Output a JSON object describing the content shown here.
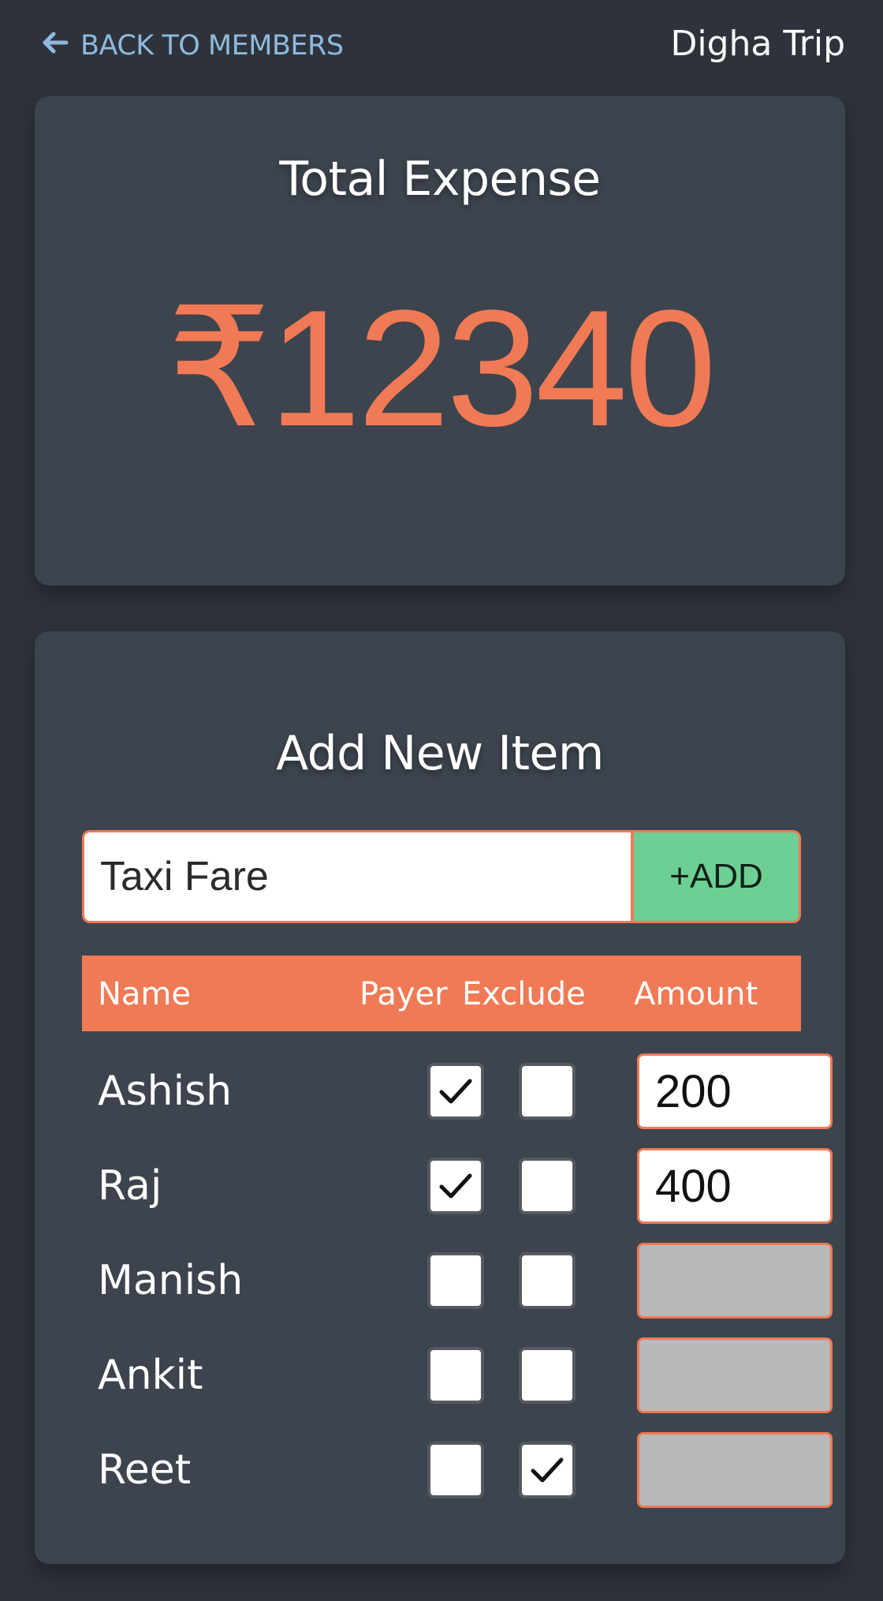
{
  "header": {
    "back_label": "Back to Members",
    "trip_title": "Digha Trip"
  },
  "total_card": {
    "title": "Total Expense",
    "amount": "₹12340"
  },
  "add_card": {
    "title": "Add New Item",
    "item_input_value": "Taxi Fare",
    "add_button_label": "+ADD",
    "columns": {
      "name": "Name",
      "payer": "Payer",
      "exclude": "Exclude",
      "amount": "Amount"
    },
    "members": [
      {
        "name": "Ashish",
        "payer": true,
        "exclude": false,
        "amount": "200",
        "amount_enabled": true
      },
      {
        "name": "Raj",
        "payer": true,
        "exclude": false,
        "amount": "400",
        "amount_enabled": true
      },
      {
        "name": "Manish",
        "payer": false,
        "exclude": false,
        "amount": "",
        "amount_enabled": false
      },
      {
        "name": "Ankit",
        "payer": false,
        "exclude": false,
        "amount": "",
        "amount_enabled": false
      },
      {
        "name": "Reet",
        "payer": false,
        "exclude": true,
        "amount": "",
        "amount_enabled": false
      }
    ]
  },
  "colors": {
    "background": "#2e333b",
    "card": "#3d444e",
    "accent": "#f07a55",
    "add_button": "#6ecf94",
    "link": "#8fb9dd",
    "disabled_input": "#b9b9bb"
  },
  "icons": {
    "back": "arrow-left-icon",
    "check": "checkmark-icon"
  }
}
